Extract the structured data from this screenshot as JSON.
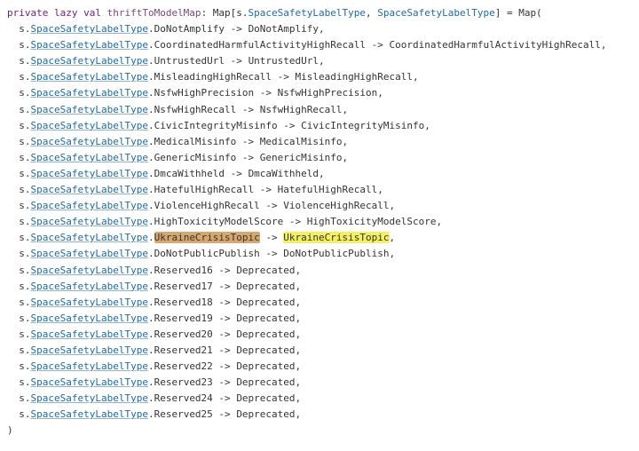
{
  "decl": {
    "modifiers": "private lazy val",
    "name": "thriftToModelMap",
    "typeExpr_prefix": ": Map[s.",
    "typeExpr_type": "SpaceSafetyLabelType",
    "typeExpr_mid": ", ",
    "typeExpr_suffix": "] = Map("
  },
  "linePrefix": "  s.",
  "typeName": "SpaceSafetyLabelType",
  "entries": [
    {
      "left": "DoNotAmplify",
      "right": "DoNotAmplify"
    },
    {
      "left": "CoordinatedHarmfulActivityHighRecall",
      "right": "CoordinatedHarmfulActivityHighRecall"
    },
    {
      "left": "UntrustedUrl",
      "right": "UntrustedUrl"
    },
    {
      "left": "MisleadingHighRecall",
      "right": "MisleadingHighRecall"
    },
    {
      "left": "NsfwHighPrecision",
      "right": "NsfwHighPrecision"
    },
    {
      "left": "NsfwHighRecall",
      "right": "NsfwHighRecall"
    },
    {
      "left": "CivicIntegrityMisinfo",
      "right": "CivicIntegrityMisinfo"
    },
    {
      "left": "MedicalMisinfo",
      "right": "MedicalMisinfo"
    },
    {
      "left": "GenericMisinfo",
      "right": "GenericMisinfo"
    },
    {
      "left": "DmcaWithheld",
      "right": "DmcaWithheld"
    },
    {
      "left": "HatefulHighRecall",
      "right": "HatefulHighRecall"
    },
    {
      "left": "ViolenceHighRecall",
      "right": "ViolenceHighRecall"
    },
    {
      "left": "HighToxicityModelScore",
      "right": "HighToxicityModelScore"
    },
    {
      "left": "UkraineCrisisTopic",
      "right": "UkraineCrisisTopic",
      "highlight": true
    },
    {
      "left": "DoNotPublicPublish",
      "right": "DoNotPublicPublish"
    },
    {
      "left": "Reserved16",
      "right": "Deprecated"
    },
    {
      "left": "Reserved17",
      "right": "Deprecated"
    },
    {
      "left": "Reserved18",
      "right": "Deprecated"
    },
    {
      "left": "Reserved19",
      "right": "Deprecated"
    },
    {
      "left": "Reserved20",
      "right": "Deprecated"
    },
    {
      "left": "Reserved21",
      "right": "Deprecated"
    },
    {
      "left": "Reserved22",
      "right": "Deprecated"
    },
    {
      "left": "Reserved23",
      "right": "Deprecated"
    },
    {
      "left": "Reserved24",
      "right": "Deprecated"
    },
    {
      "left": "Reserved25",
      "right": "Deprecated"
    }
  ],
  "closing": ")"
}
